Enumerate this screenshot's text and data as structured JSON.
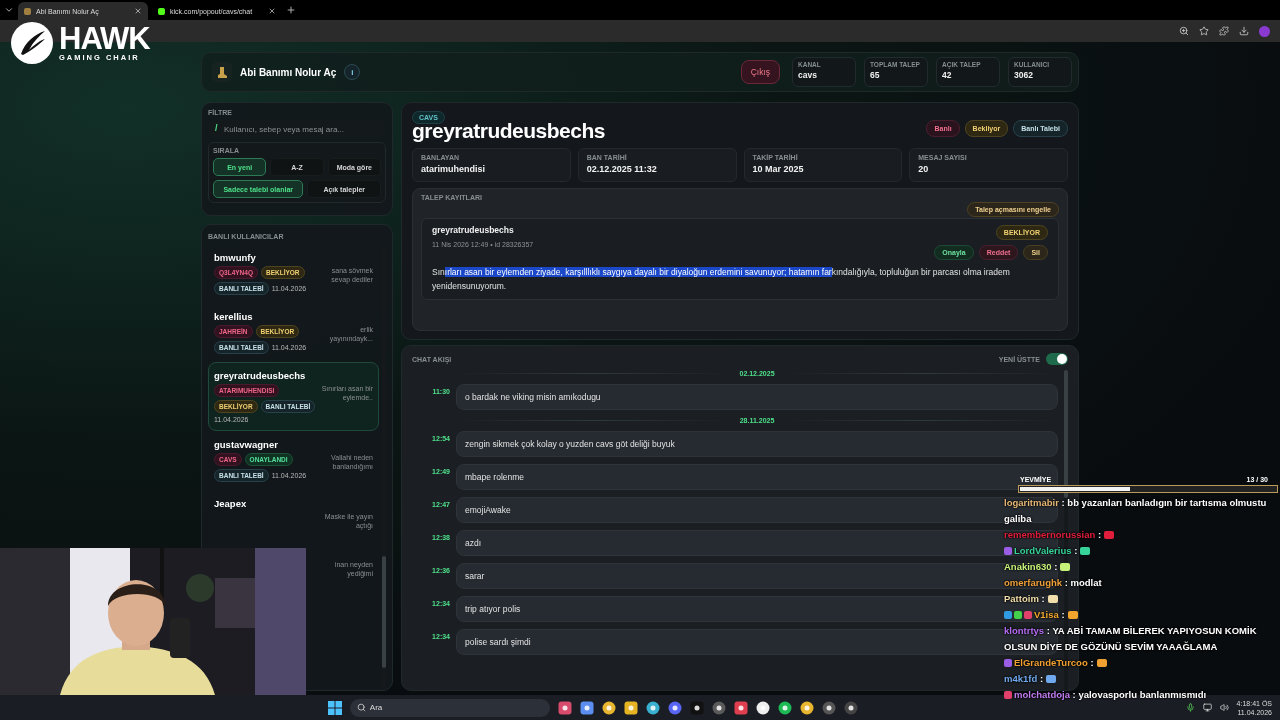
{
  "browser": {
    "tabs": [
      {
        "title": "Abi Banımı Nolur Aç",
        "selected": true
      },
      {
        "title": "kick.com/popout/cavs/chat",
        "selected": false
      }
    ]
  },
  "logo": {
    "title": "HAWK",
    "subtitle": "GAMING CHAIR"
  },
  "header": {
    "title": "Abi Banımı Nolur Aç",
    "info": "i",
    "logout": "Çıkış",
    "stats": [
      {
        "label": "KANAL",
        "value": "cavs"
      },
      {
        "label": "TOPLAM TALEP",
        "value": "65"
      },
      {
        "label": "AÇIK TALEP",
        "value": "42"
      },
      {
        "label": "KULLANICI",
        "value": "3062"
      }
    ]
  },
  "filter": {
    "title": "FİLTRE",
    "search_prefix": "/",
    "search_placeholder": "Kullanıcı, sebep veya mesaj ara...",
    "sort_label": "SIRALA",
    "sort_options": [
      {
        "label": "En yeni",
        "selected": true
      },
      {
        "label": "A-Z",
        "selected": false
      },
      {
        "label": "Moda göre",
        "selected": false
      }
    ],
    "toggles": [
      {
        "label": "Sadece talebi olanlar",
        "selected": true
      },
      {
        "label": "Açık talepler",
        "selected": false
      }
    ]
  },
  "banned_list": {
    "title": "BANLI KULLANICILAR",
    "items": [
      {
        "name": "bmwunfy",
        "selected": false,
        "badges": [
          {
            "text": "Q3L4YN4Q",
            "kind": "channel"
          },
          {
            "text": "BEKLİYOR",
            "kind": "pending"
          },
          {
            "text": "BANLI TALEBİ",
            "kind": "request"
          }
        ],
        "date": "11.04.2026",
        "snippet": "sana sövmek sevap dediler"
      },
      {
        "name": "kerellius",
        "selected": false,
        "badges": [
          {
            "text": "JAHREİN",
            "kind": "channel"
          },
          {
            "text": "BEKLİYOR",
            "kind": "pending"
          },
          {
            "text": "BANLI TALEBİ",
            "kind": "request"
          }
        ],
        "date": "11.04.2026",
        "snippet": "erlik yayınındayk..."
      },
      {
        "name": "greyratrudeusbechs",
        "selected": true,
        "badges": [
          {
            "text": "ATARIMUHENDISI",
            "kind": "channel"
          },
          {
            "text": "BEKLİYOR",
            "kind": "pending"
          },
          {
            "text": "BANLI TALEBİ",
            "kind": "request"
          }
        ],
        "date": "11.04.2026",
        "snippet": "Sınırları asan bir eylemde.."
      },
      {
        "name": "gustavwagner",
        "selected": false,
        "badges": [
          {
            "text": "CAVS",
            "kind": "channel"
          },
          {
            "text": "ONAYLANDI",
            "kind": "approved"
          },
          {
            "text": "BANLI TALEBİ",
            "kind": "request"
          }
        ],
        "date": "11.04.2026",
        "snippet": "Vallahi neden banlandığımı"
      },
      {
        "name": "Jeapex",
        "selected": false,
        "snippet": "Maske ile yayın açtığı"
      },
      {
        "selected": false,
        "snippet": "inan neyden yediğimi"
      }
    ]
  },
  "detail": {
    "channel_tag": "CAVS",
    "username": "greyratrudeusbechs",
    "status_pills": [
      {
        "text": "Banlı",
        "kind": "banned"
      },
      {
        "text": "Bekliyor",
        "kind": "pending"
      },
      {
        "text": "Banlı Talebi",
        "kind": "request"
      }
    ],
    "info": [
      {
        "label": "BANLAYAN",
        "value": "atarimuhendisi"
      },
      {
        "label": "BAN TARİHİ",
        "value": "02.12.2025 11:32"
      },
      {
        "label": "TAKİP TARİHİ",
        "value": "10 Mar 2025"
      },
      {
        "label": "MESAJ SAYISI",
        "value": "20"
      }
    ],
    "requests": {
      "title": "TALEP KAYITLARI",
      "block_button": "Talep açmasını engelle",
      "entry": {
        "user": "greyratrudeusbechs",
        "meta": "11 Nis 2026 12:49 • id 28326357",
        "status": {
          "text": "BEKLİYOR",
          "kind": "pending"
        },
        "actions": [
          {
            "label": "Onayla",
            "kind": "approve"
          },
          {
            "label": "Reddet",
            "kind": "reject"
          },
          {
            "label": "Sil",
            "kind": "delete"
          }
        ],
        "message": [
          {
            "text": "Sın",
            "selected": false
          },
          {
            "text": "ırları asan bir eylemden ziyade, karşılllıklı saygıya dayalı bir diyaloğun erdemini savunuyor; hatamın far",
            "selected": true
          },
          {
            "text": "kındalığıyla, topluluğun bir parcası olma iradem yenidensunuyorum.",
            "selected": false
          }
        ]
      }
    }
  },
  "chat_feed": {
    "title": "CHAT AKIŞI",
    "newest_first": {
      "label": "YENİ ÜSTTE",
      "on": true
    },
    "groups": [
      {
        "date": "02.12.2025",
        "messages": [
          {
            "time": "11:30",
            "text": "o bardak ne viking misin amıkodugu"
          }
        ]
      },
      {
        "date": "28.11.2025",
        "messages": [
          {
            "time": "12:54",
            "text": "zengin sikmek çok kolay o yuzden cavs göt deliği buyuk"
          },
          {
            "time": "12:49",
            "text": "mbape rolenme"
          },
          {
            "time": "12:47",
            "text": "emojiAwake"
          },
          {
            "time": "12:38",
            "text": "azdı"
          },
          {
            "time": "12:36",
            "text": "sarar"
          },
          {
            "time": "12:34",
            "text": "trip atıyor polis"
          },
          {
            "time": "12:34",
            "text": "polise sardı şimdi"
          }
        ]
      }
    ]
  },
  "stream_chat": {
    "goal": {
      "label": "YEVMİYE",
      "count": "13 / 30",
      "level": 0.43
    },
    "messages": [
      {
        "user": "logaritmabir",
        "color": "#e6b877",
        "kind": "text",
        "text": ": bb yazanları banladıgın bir tartısma olmustu galiba"
      },
      {
        "user": "remembernorussian",
        "color": "#e01e3c",
        "kind": "emote",
        "text": ":"
      },
      {
        "user": "LordValerius",
        "color": "#37d49a",
        "kind": "emote",
        "text": ":",
        "badges": [
          {
            "color": "#9b5de5"
          }
        ]
      },
      {
        "user": "Anakin630",
        "color": "#c6f27a",
        "kind": "emote",
        "text": ":"
      },
      {
        "user": "omerfarughk",
        "color": "#f0a23a",
        "kind": "text",
        "text": ": modlat"
      },
      {
        "user": "Pattoim",
        "color": "#f2deaa",
        "kind": "emote",
        "text": ":"
      },
      {
        "user": "V1isa",
        "color": "#f2a62e",
        "kind": "emote",
        "text": ":",
        "badges": [
          {
            "color": "#2f9be0"
          },
          {
            "color": "#44d04a"
          },
          {
            "color": "#e0406a"
          }
        ]
      },
      {
        "user": "klontrtys",
        "color": "#b46cf2",
        "kind": "text",
        "text": ": YA ABİ TAMAM BİLEREK YAPIYOSUN KOMİK OLSUN DİYE DE GÖZÜNÜ SEVİM YAAAĞLAMA"
      },
      {
        "user": "ElGrandeTurcoo",
        "color": "#f0a030",
        "kind": "emote",
        "text": ":",
        "badges": [
          {
            "color": "#9b5de5"
          }
        ]
      },
      {
        "user": "m4k1fd",
        "color": "#6fa8ec",
        "kind": "emote",
        "text": ":"
      },
      {
        "user": "molchatdoja",
        "color": "#c07cf0",
        "kind": "text",
        "text": ": yalovasporlu banlanmısmıdı",
        "badges": [
          {
            "color": "#e0406a"
          }
        ]
      }
    ]
  },
  "taskbar": {
    "search_placeholder": "Ara",
    "time": "4:18:41 ÖS",
    "date": "11.04.2026"
  }
}
